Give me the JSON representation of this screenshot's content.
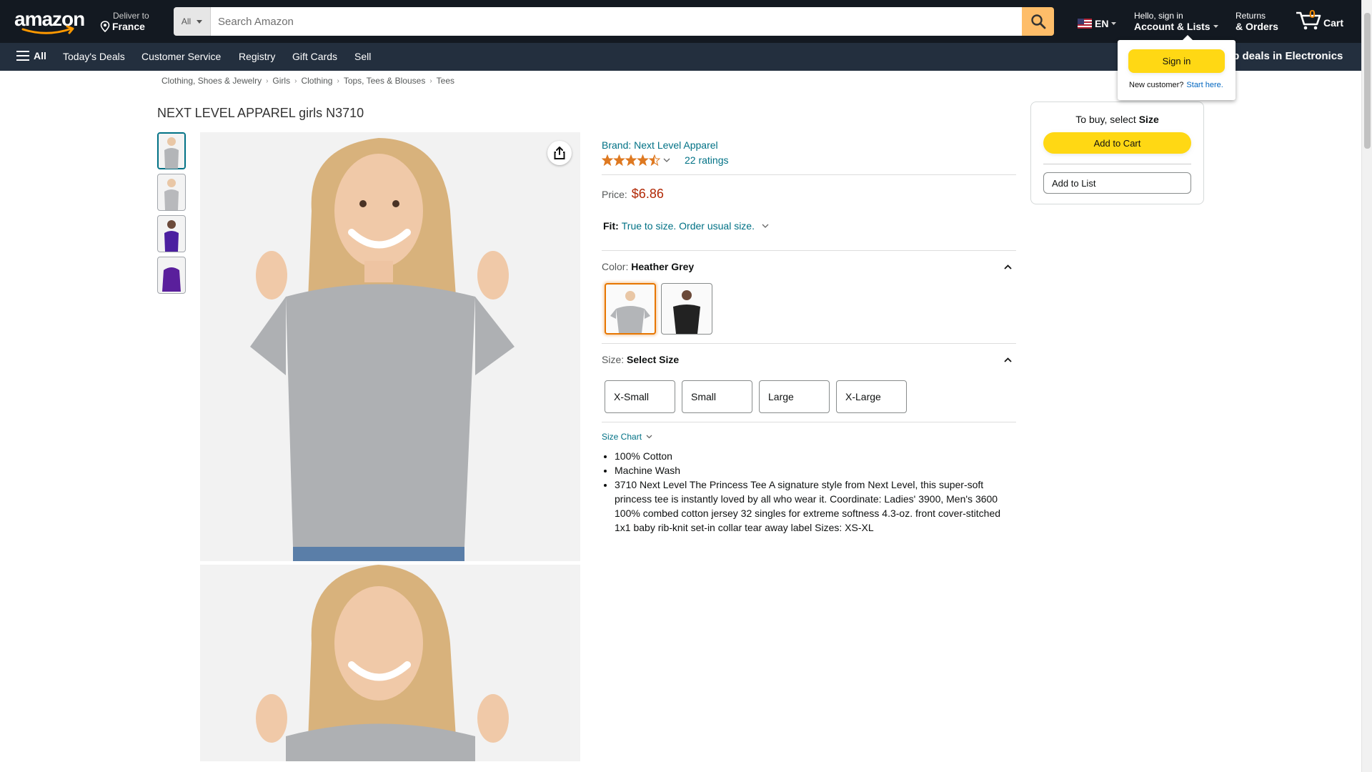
{
  "header": {
    "deliver_line1": "Deliver to",
    "deliver_line2": "France",
    "search_category": "All",
    "search_placeholder": "Search Amazon",
    "language": "EN",
    "account_line1": "Hello, sign in",
    "account_line2": "Account & Lists",
    "returns_line1": "Returns",
    "returns_line2": "& Orders",
    "cart_count": "0",
    "cart_label": "Cart",
    "colors": {
      "bg": "#131921",
      "search_button": "#febd69",
      "cart_count": "#f08804"
    }
  },
  "nav": {
    "all_label": "All",
    "items": [
      "Today's Deals",
      "Customer Service",
      "Registry",
      "Gift Cards",
      "Sell"
    ],
    "promo": "op deals in Electronics"
  },
  "breadcrumb": [
    "Clothing, Shoes & Jewelry",
    "Girls",
    "Clothing",
    "Tops, Tees & Blouses",
    "Tees"
  ],
  "product": {
    "title": "NEXT LEVEL APPAREL girls N3710",
    "brand": "Brand: Next Level Apparel",
    "rating_stars": 4.5,
    "ratings": "22 ratings",
    "price_label": "Price:",
    "price": "$6.86",
    "fit_label": "Fit:",
    "fit_value": "True to size. Order usual size.",
    "color_label": "Color:",
    "color_value": "Heather Grey",
    "color_options": [
      "heather-grey",
      "black"
    ],
    "size_label": "Size:",
    "size_value": "Select Size",
    "sizes": [
      "X-Small",
      "Small",
      "Large",
      "X-Large"
    ],
    "size_chart": "Size Chart",
    "bullets": [
      "100% Cotton",
      "Machine Wash",
      "3710 Next Level The Princess Tee A signature style from Next Level, this super-soft princess tee is instantly loved by all who wear it. Coordinate: Ladies' 3900, Men's 3600 100% combed cotton jersey 32 singles for extreme softness 4.3-oz. front cover-stitched 1x1 baby rib-knit set-in collar tear away label Sizes: XS-XL"
    ]
  },
  "buybox": {
    "select_prefix": "To buy, select",
    "select_bold": "Size",
    "add_to_cart": "Add to Cart",
    "add_to_list": "Add to List"
  },
  "signin_flyout": {
    "button": "Sign in",
    "new_customer": "New customer?",
    "start_here": "Start here."
  }
}
